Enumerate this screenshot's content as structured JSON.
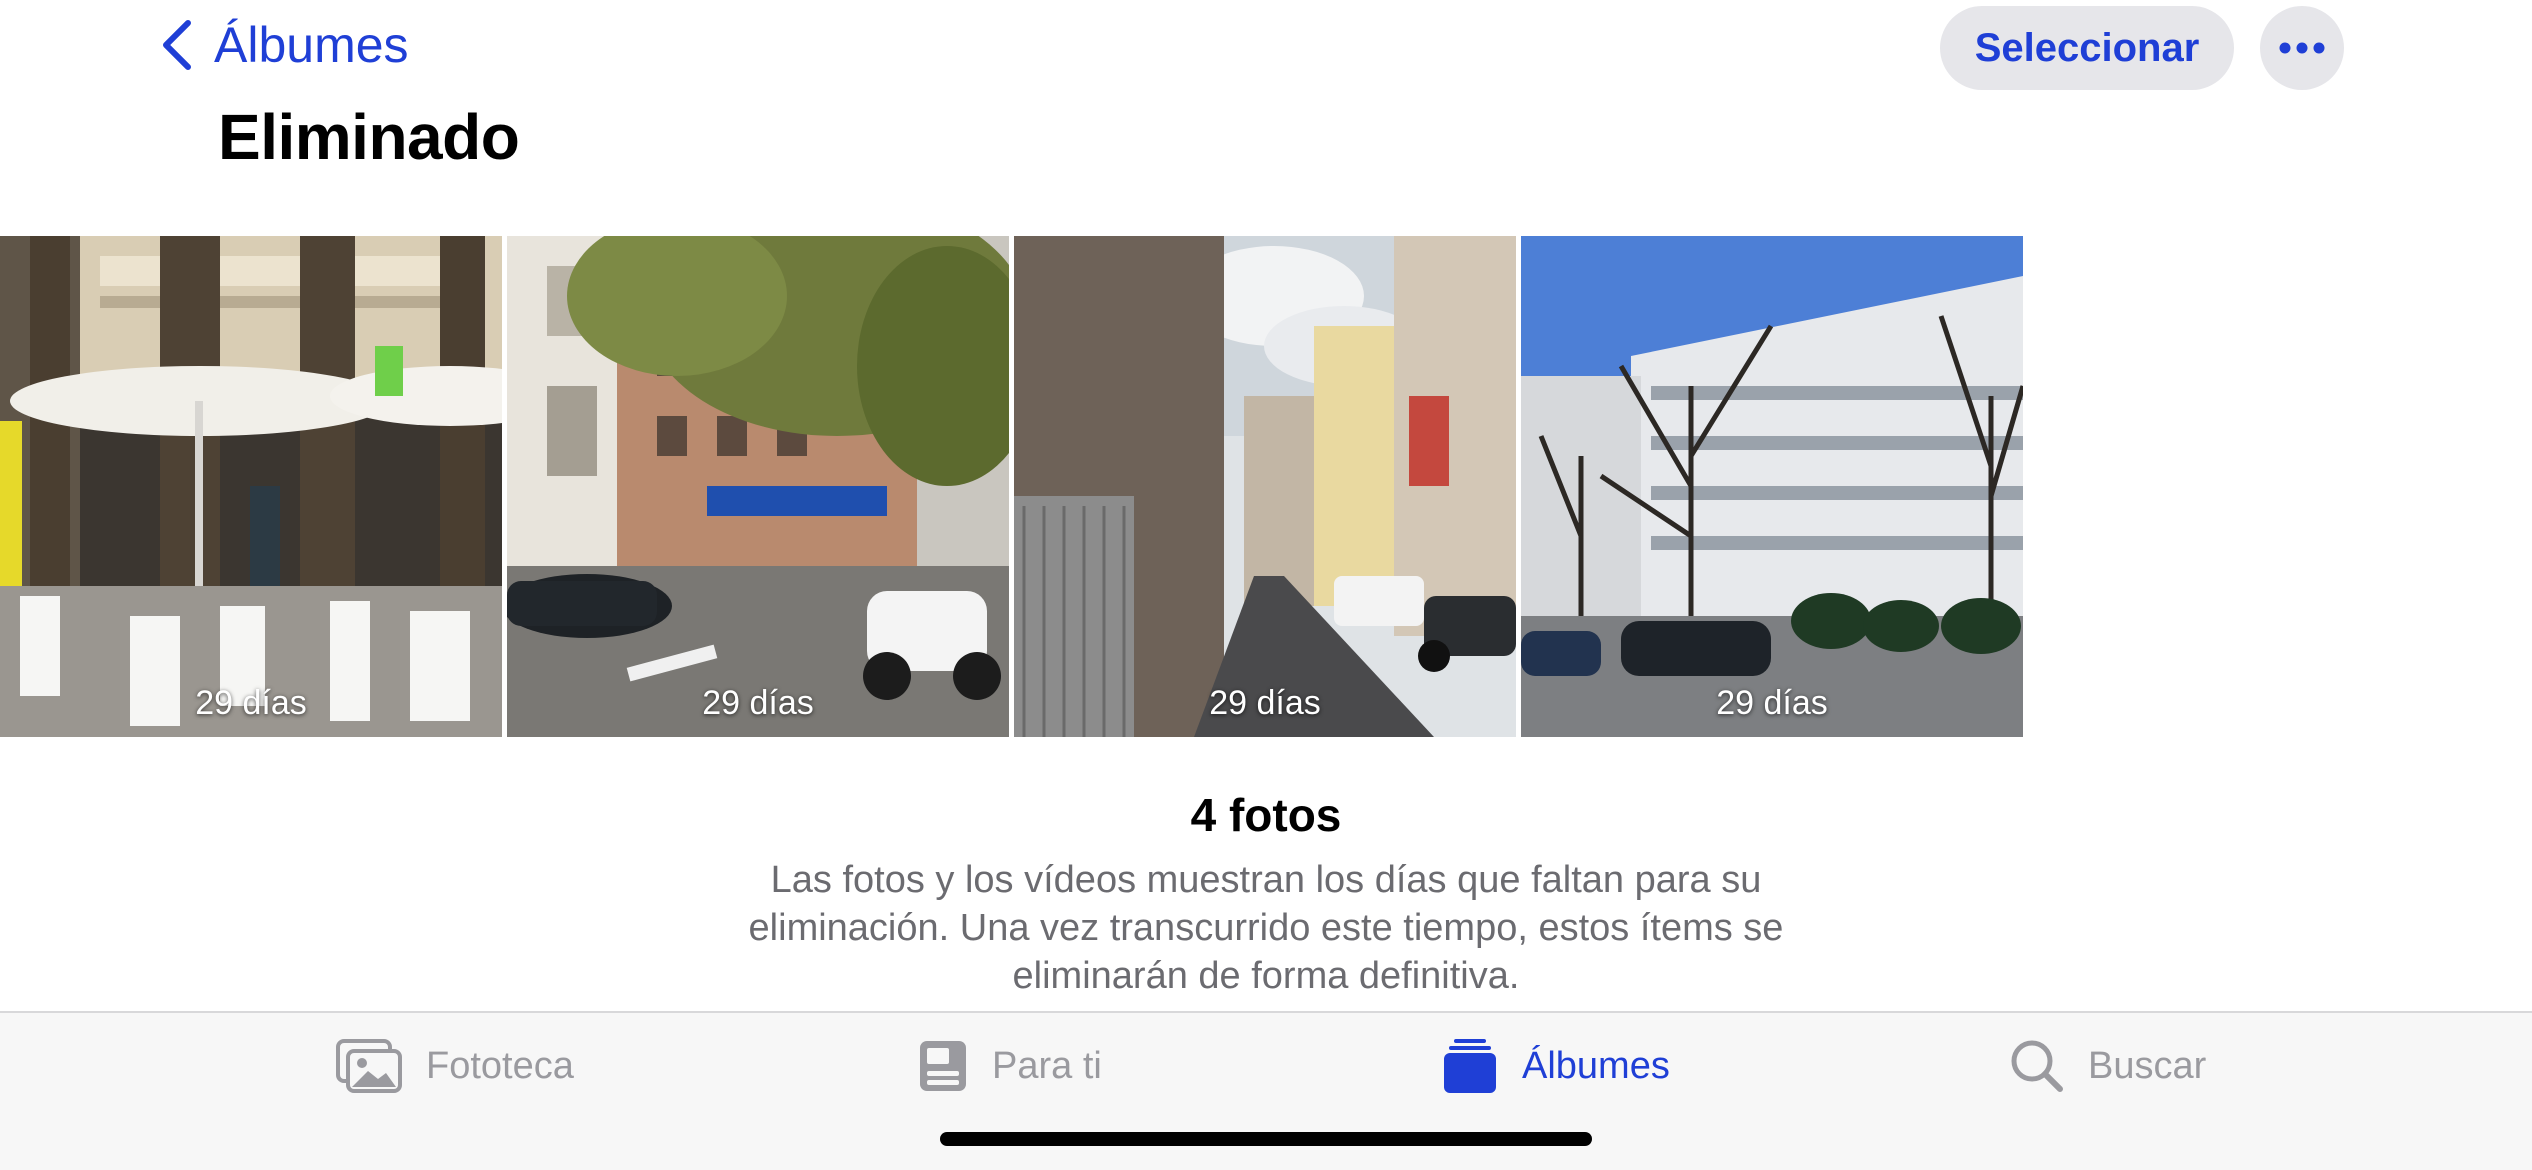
{
  "nav": {
    "back_label": "Álbumes",
    "title": "Eliminado",
    "select_label": "Seleccionar",
    "more_icon": "ellipsis-icon"
  },
  "photos": [
    {
      "days_label": "29 días",
      "description": "cafe terrace with umbrellas"
    },
    {
      "days_label": "29 días",
      "description": "street with trees and scooter"
    },
    {
      "days_label": "29 días",
      "description": "narrow street with buildings"
    },
    {
      "days_label": "29 días",
      "description": "office building with bare trees"
    }
  ],
  "info": {
    "count": "4 fotos",
    "description": "Las fotos y los vídeos muestran los días que faltan para su eliminación. Una vez transcurrido este tiempo, estos ítems se eliminarán de forma definitiva."
  },
  "tabs": [
    {
      "label": "Fototeca",
      "icon": "photo-library-icon",
      "active": false
    },
    {
      "label": "Para ti",
      "icon": "for-you-icon",
      "active": false
    },
    {
      "label": "Álbumes",
      "icon": "albums-icon",
      "active": true
    },
    {
      "label": "Buscar",
      "icon": "search-icon",
      "active": false
    }
  ],
  "colors": {
    "accent": "#1f3fd6",
    "inactive": "#9a9a9f",
    "button_bg": "#e6e6ea"
  }
}
